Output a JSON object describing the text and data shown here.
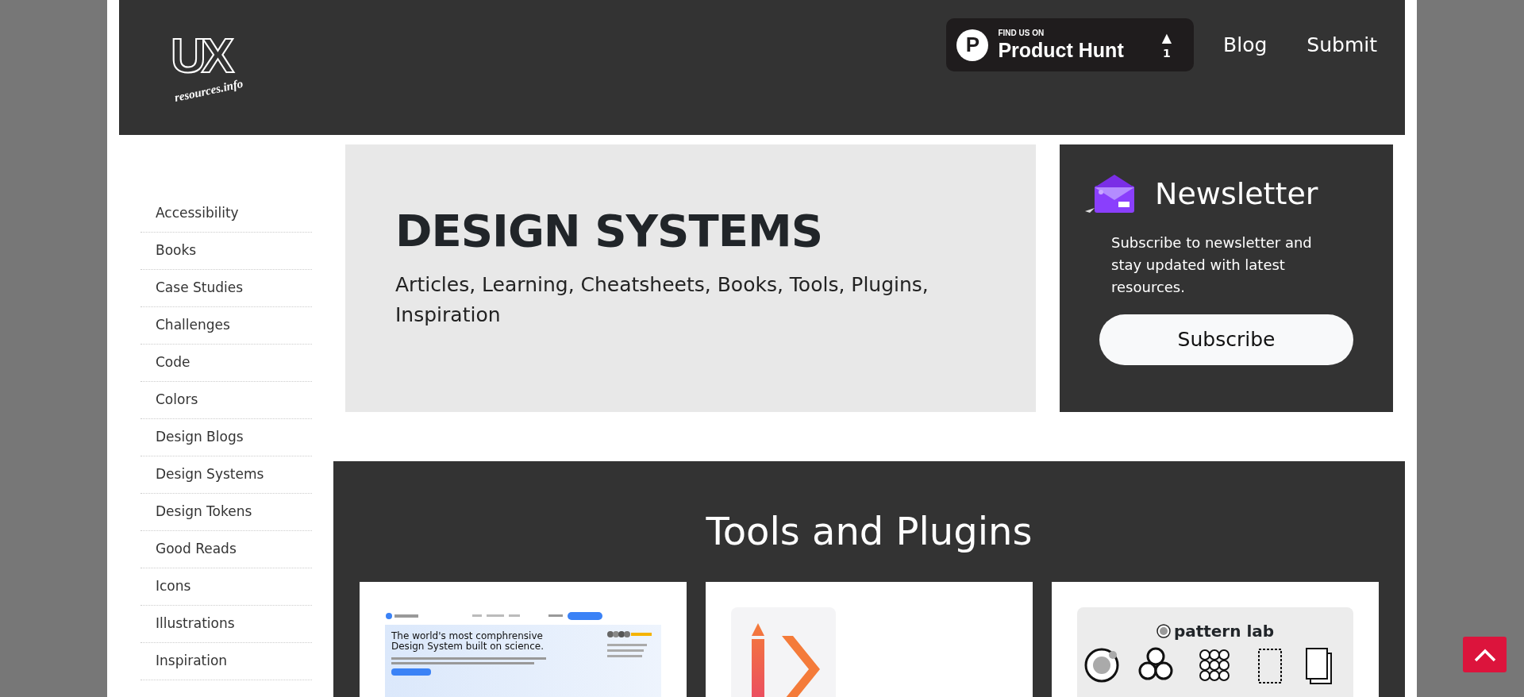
{
  "header": {
    "logo": {
      "mark": "UX",
      "tagline": "resources.info"
    },
    "product_hunt": {
      "logo_letter": "P",
      "caption": "FIND US ON",
      "name": "Product Hunt",
      "arrow": "▲",
      "votes": "1"
    },
    "nav": [
      {
        "label": "Blog"
      },
      {
        "label": "Submit"
      }
    ]
  },
  "sidebar": {
    "items": [
      {
        "label": "Accessibility"
      },
      {
        "label": "Books"
      },
      {
        "label": "Case Studies"
      },
      {
        "label": "Challenges"
      },
      {
        "label": "Code"
      },
      {
        "label": "Colors"
      },
      {
        "label": "Design Blogs"
      },
      {
        "label": "Design Systems"
      },
      {
        "label": "Design Tokens"
      },
      {
        "label": "Good Reads"
      },
      {
        "label": "Icons"
      },
      {
        "label": "Illustrations"
      },
      {
        "label": "Inspiration"
      }
    ]
  },
  "hero": {
    "title": "DESIGN SYSTEMS",
    "subtitle": "Articles, Learning, Cheatsheets, Books, Tools, Plugins, Inspiration"
  },
  "newsletter": {
    "title": "Newsletter",
    "text": "Subscribe to newsletter and stay updated with latest resources.",
    "button": "Subscribe"
  },
  "tools": {
    "title": "Tools and Plugins",
    "cards": [
      {
        "kind": "site",
        "headline": "The world's most comphrensive Design System built on science."
      },
      {
        "kind": "logo"
      },
      {
        "kind": "pattern",
        "name": "pattern lab"
      }
    ]
  }
}
